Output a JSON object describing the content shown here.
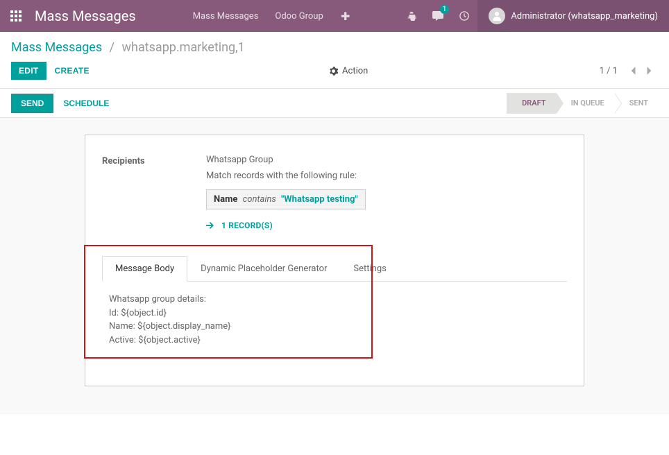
{
  "navbar": {
    "appTitle": "Mass Messages",
    "menuItems": [
      "Mass Messages",
      "Odoo Group"
    ],
    "messagesBadge": "1",
    "userName": "Administrator (whatsapp_marketing)"
  },
  "breadcrumb": {
    "root": "Mass Messages",
    "current": "whatsapp.marketing,1"
  },
  "controls": {
    "edit": "Edit",
    "create": "Create",
    "action": "Action",
    "pager": "1 / 1"
  },
  "statusBar": {
    "send": "Send",
    "schedule": "Schedule",
    "stages": [
      "DRAFT",
      "IN QUEUE",
      "SENT"
    ],
    "activeStageIndex": 0
  },
  "form": {
    "recipientsLabel": "Recipients",
    "recipientsValue": "Whatsapp Group",
    "matchRecordsLine": "Match records with the following rule:",
    "rule": {
      "field": "Name",
      "operator": "contains",
      "value": "\"Whatsapp testing\""
    },
    "recordsLink": "1 RECORD(S)"
  },
  "tabs": {
    "labels": [
      "Message Body",
      "Dynamic Placeholder Generator",
      "Settings"
    ],
    "activeIndex": 0,
    "messageBodyLines": [
      "Whatsapp group details:",
      "Id: ${object.id}",
      "Name: ${object.display_name}",
      "Active: ${object.active}"
    ]
  }
}
